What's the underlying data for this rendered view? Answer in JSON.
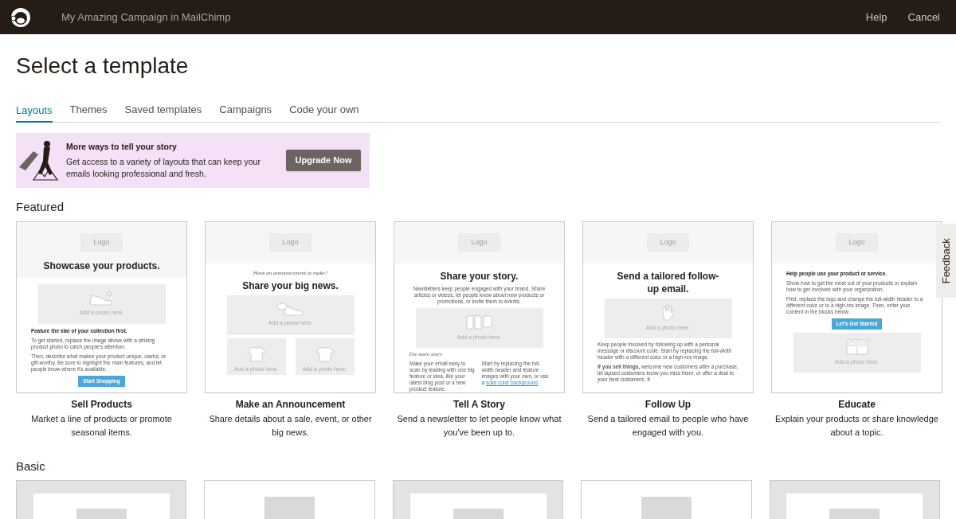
{
  "header": {
    "title": "My Amazing Campaign in MailChimp",
    "links": [
      "Help",
      "Cancel"
    ]
  },
  "page_title": "Select a template",
  "tabs": [
    {
      "label": "Layouts",
      "selected": true
    },
    {
      "label": "Themes",
      "selected": false
    },
    {
      "label": "Saved templates",
      "selected": false
    },
    {
      "label": "Campaigns",
      "selected": false
    },
    {
      "label": "Code your own",
      "selected": false
    }
  ],
  "banner": {
    "title": "More ways to tell your story",
    "text": "Get access to a variety of layouts that can keep your emails looking professional and fresh.",
    "button": "Upgrade Now"
  },
  "featured": {
    "title": "Featured",
    "templates": [
      {
        "name": "Sell Products",
        "description": "Market a line of products or promote seasonal items.",
        "preview": {
          "header": [
            {
              "kind": "logo",
              "text": "Logo"
            },
            {
              "kind": "heading",
              "text": "Showcase your products."
            }
          ],
          "body": [
            {
              "kind": "photo",
              "text": "Add a photo here."
            },
            {
              "kind": "subheading",
              "text": "Feature the star of your collection first."
            },
            {
              "kind": "paragraph",
              "text": "To get started, replace the image above with a striking product photo to catch people's attention."
            },
            {
              "kind": "paragraph",
              "text": "Then, describe what makes your product unique, useful, or gift-worthy. Be sure to highlight the main features, and let people know where it's available."
            },
            {
              "kind": "button",
              "text": "Start Shopping"
            }
          ]
        }
      },
      {
        "name": "Make an Announcement",
        "description": "Share details about a sale, event, or other big news.",
        "preview": {
          "header": [
            {
              "kind": "logo",
              "text": "Logo"
            }
          ],
          "body": [
            {
              "kind": "eyebrow",
              "text": "Have an announcement to make?"
            },
            {
              "kind": "heading",
              "text": "Share your big news."
            },
            {
              "kind": "photo",
              "text": "Add a photo here."
            },
            {
              "kind": "photo_pair",
              "texts": [
                "Add a photo here.",
                "Add a photo here."
              ]
            }
          ]
        }
      },
      {
        "name": "Tell A Story",
        "description": "Send a newsletter to let people know what you've been up to.",
        "preview": {
          "header": [
            {
              "kind": "logo",
              "text": "Logo"
            }
          ],
          "body": [
            {
              "kind": "heading",
              "text": "Share your story."
            },
            {
              "kind": "paragraph",
              "text": "Newsletters keep people engaged with your brand. Share articles or videos, let people know about new products or promotions, or invite them to events.",
              "centered": true
            },
            {
              "kind": "photo",
              "text": "Add a photo here."
            },
            {
              "kind": "eyebrow",
              "text": "The main story"
            },
            {
              "kind": "columns",
              "columns": [
                {
                  "text": "Make your email easy to scan by leading with one big feature or idea, like your latest blog post or a new product feature."
                },
                {
                  "text": "Start by replacing the full-width header and feature images with your own, or use a",
                  "link": "solid color background",
                  "after": "."
                }
              ]
            }
          ]
        }
      },
      {
        "name": "Follow Up",
        "description": "Send a tailored email to people who have engaged with you.",
        "preview": {
          "header": [
            {
              "kind": "logo",
              "text": "Logo"
            }
          ],
          "body": [
            {
              "kind": "heading",
              "text": "Send a tailored follow-up email."
            },
            {
              "kind": "photo",
              "text": "Add a photo here."
            },
            {
              "kind": "paragraph",
              "text": "Keep people involved by following up with a personal message or discount code. Start by replacing the full-width header with a different color or a high-res image."
            },
            {
              "kind": "paragraph",
              "text": "**If you sell things,** welcome new customers after a purchase, let lapsed customers know you miss them, or offer a deal to your best customers. If"
            }
          ]
        }
      },
      {
        "name": "Educate",
        "description": "Explain your products or share knowledge about a topic.",
        "preview": {
          "header": [
            {
              "kind": "logo",
              "text": "Logo"
            }
          ],
          "body": [
            {
              "kind": "subheading",
              "text": "Help people use your product or service."
            },
            {
              "kind": "paragraph",
              "text": "Show how to get the most out of your products or explain how to get involved with your organization."
            },
            {
              "kind": "paragraph",
              "text": "First, replace the logo and change the full-width header to a different color or to a high-res image. Then, enter your content in the blocks below."
            },
            {
              "kind": "button",
              "text": "Let's Get Started"
            },
            {
              "kind": "photo",
              "text": "Add a photo here."
            }
          ]
        }
      }
    ]
  },
  "basic": {
    "title": "Basic",
    "templates": [
      {
        "kind": "banded"
      },
      {
        "kind": "plain"
      },
      {
        "kind": "banded"
      },
      {
        "kind": "plain"
      },
      {
        "kind": "banded"
      }
    ]
  },
  "feedback": "Feedback"
}
